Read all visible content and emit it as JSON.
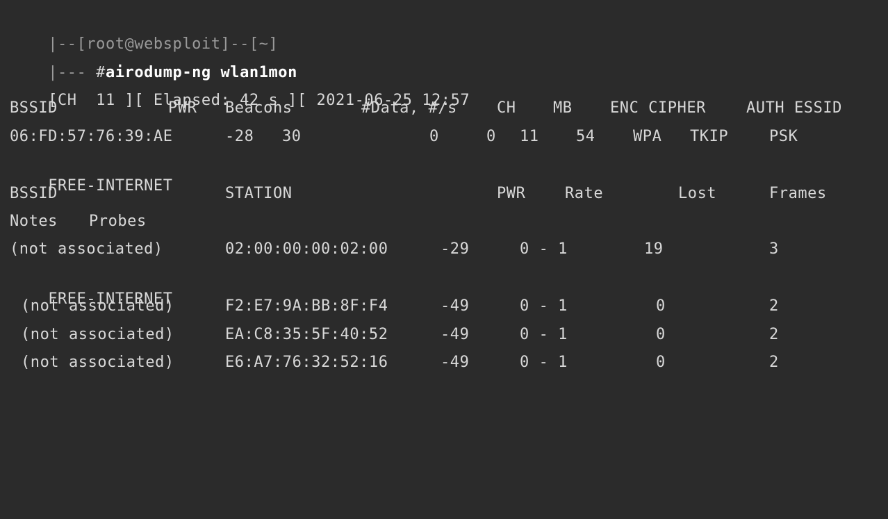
{
  "prompt": {
    "user_line": "|--[root@websploit]--[~]",
    "cmd_prefix": "|--- ",
    "hash": "#",
    "command": "airodump-ng wlan1mon"
  },
  "status_line": "[CH  11 ][ Elapsed: 42 s ][ 2021-06-25 12:57",
  "ap_table": {
    "headers": {
      "bssid": "BSSID",
      "pwr": "PWR",
      "beacons": "Beacons",
      "data": "#Data, #/s",
      "ch": "CH",
      "mb": "MB",
      "enc_cipher": "ENC CIPHER",
      "auth_essid": "AUTH ESSID"
    },
    "rows": [
      {
        "bssid": "06:FD:57:76:39:AE",
        "pwr": "-28",
        "beacons": "30",
        "data": "0",
        "per_s": "0",
        "ch": "11",
        "mb": "54",
        "enc": "WPA",
        "cipher": "TKIP",
        "auth": "PSK",
        "essid": "FREE-INTERNET"
      }
    ]
  },
  "station_table": {
    "headers": {
      "bssid": "BSSID",
      "station": "STATION",
      "pwr": "PWR",
      "rate": "Rate",
      "lost": "Lost",
      "frames": "Frames",
      "notes": "Notes",
      "probes": "Probes"
    },
    "rows": [
      {
        "bssid": "(not associated)",
        "station": "02:00:00:00:02:00",
        "pwr": "-29",
        "rate": "0 - 1",
        "lost": "19",
        "frames": "3",
        "probes": "FREE-INTERNET"
      },
      {
        "bssid": "(not associated)",
        "station": "F2:E7:9A:BB:8F:F4",
        "pwr": "-49",
        "rate": "0 - 1",
        "lost": "0",
        "frames": "2"
      },
      {
        "bssid": "(not associated)",
        "station": "EA:C8:35:5F:40:52",
        "pwr": "-49",
        "rate": "0 - 1",
        "lost": "0",
        "frames": "2"
      },
      {
        "bssid": "(not associated)",
        "station": "E6:A7:76:32:52:16",
        "pwr": "-49",
        "rate": "0 - 1",
        "lost": "0",
        "frames": "2"
      }
    ]
  }
}
